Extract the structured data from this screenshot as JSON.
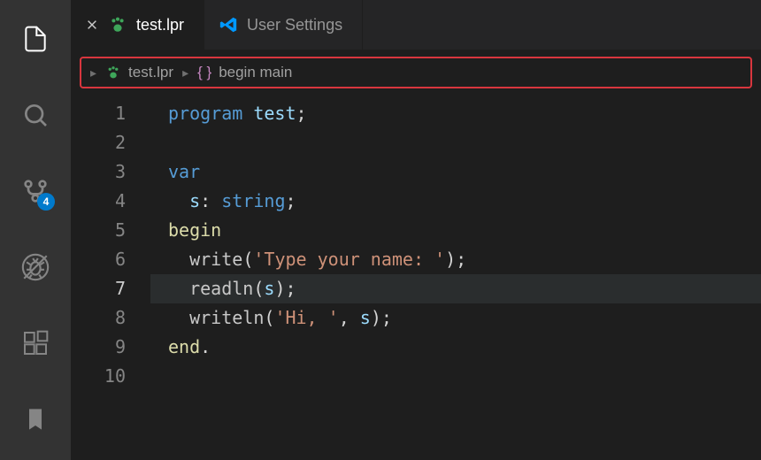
{
  "activityBar": {
    "scmBadge": "4"
  },
  "tabs": [
    {
      "label": "test.lpr",
      "active": true,
      "iconColor": "#3ea65a"
    },
    {
      "label": "User Settings",
      "active": false
    }
  ],
  "breadcrumb": {
    "file": "test.lpr",
    "symbol": "begin main"
  },
  "code": {
    "currentLine": 7,
    "lines": [
      {
        "n": 1,
        "tokens": [
          [
            "kw",
            "program"
          ],
          [
            "sp",
            " "
          ],
          [
            "id",
            "test"
          ],
          [
            "punc",
            ";"
          ]
        ]
      },
      {
        "n": 2,
        "tokens": []
      },
      {
        "n": 3,
        "tokens": [
          [
            "kw",
            "var"
          ]
        ]
      },
      {
        "n": 4,
        "tokens": [
          [
            "sp",
            "  "
          ],
          [
            "id",
            "s"
          ],
          [
            "punc",
            ":"
          ],
          [
            "sp",
            " "
          ],
          [
            "kw",
            "string"
          ],
          [
            "punc",
            ";"
          ]
        ]
      },
      {
        "n": 5,
        "tokens": [
          [
            "begin",
            "begin"
          ]
        ]
      },
      {
        "n": 6,
        "tokens": [
          [
            "sp",
            "  "
          ],
          [
            "fn",
            "write"
          ],
          [
            "punc",
            "("
          ],
          [
            "str",
            "'Type your name: '"
          ],
          [
            "punc",
            ")"
          ],
          [
            "punc",
            ";"
          ]
        ]
      },
      {
        "n": 7,
        "tokens": [
          [
            "sp",
            "  "
          ],
          [
            "fn",
            "readln"
          ],
          [
            "punc",
            "("
          ],
          [
            "id",
            "s"
          ],
          [
            "punc",
            ")"
          ],
          [
            "punc",
            ";"
          ]
        ]
      },
      {
        "n": 8,
        "tokens": [
          [
            "sp",
            "  "
          ],
          [
            "fn",
            "writeln"
          ],
          [
            "punc",
            "("
          ],
          [
            "str",
            "'Hi, '"
          ],
          [
            "punc",
            ","
          ],
          [
            "sp",
            " "
          ],
          [
            "id",
            "s"
          ],
          [
            "punc",
            ")"
          ],
          [
            "punc",
            ";"
          ]
        ]
      },
      {
        "n": 9,
        "tokens": [
          [
            "begin",
            "end"
          ],
          [
            "dot",
            "."
          ]
        ]
      },
      {
        "n": 10,
        "tokens": []
      }
    ]
  }
}
